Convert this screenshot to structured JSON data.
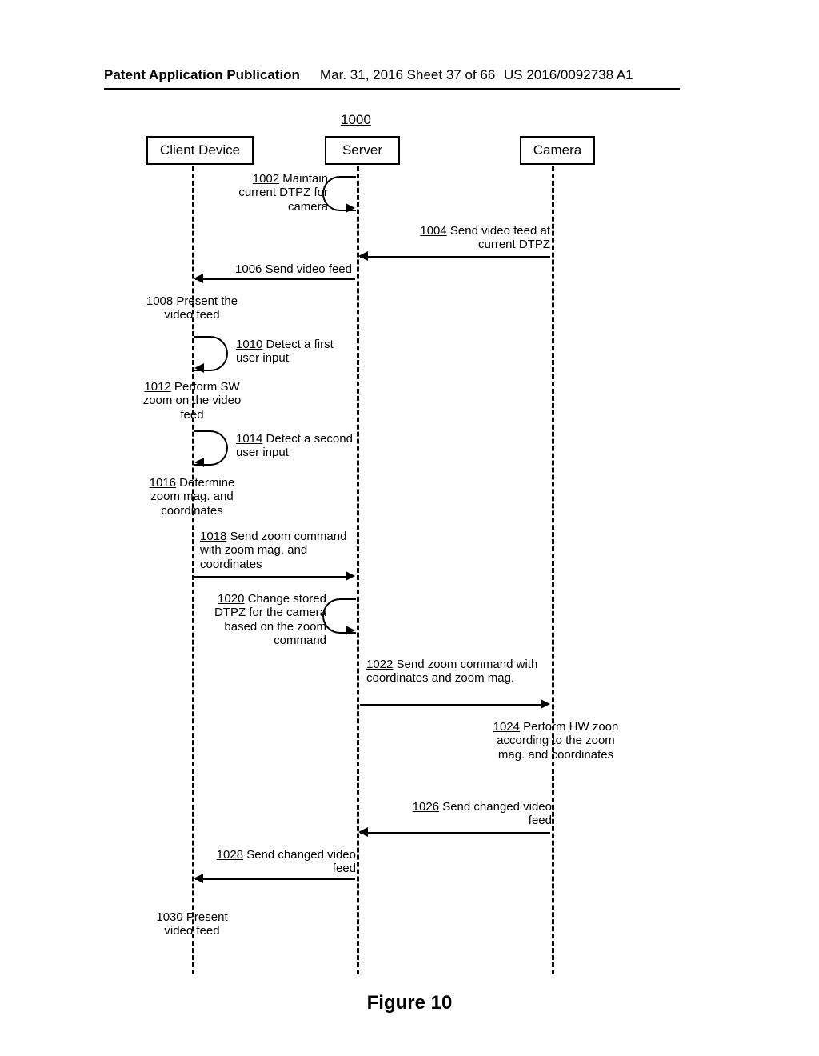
{
  "header": {
    "left": "Patent Application Publication",
    "mid": "Mar. 31, 2016  Sheet 37 of 66",
    "right": "US 2016/0092738 A1"
  },
  "figure": {
    "number": "1000",
    "caption": "Figure 10",
    "actors": {
      "client": "Client Device",
      "server": "Server",
      "camera": "Camera"
    },
    "steps": {
      "s1002_num": "1002",
      "s1002_txt": " Maintain current DTPZ for camera",
      "s1004_num": "1004",
      "s1004_txt": " Send video feed at current DTPZ",
      "s1006_num": "1006",
      "s1006_txt": " Send video feed",
      "s1008_num": "1008",
      "s1008_txt": " Present the video feed",
      "s1010_num": "1010",
      "s1010_txt": " Detect a first user input",
      "s1012_num": "1012",
      "s1012_txt": " Perform SW zoom on the video feed",
      "s1014_num": "1014",
      "s1014_txt": " Detect a second user input",
      "s1016_num": "1016",
      "s1016_txt": " Determine zoom mag. and coordinates",
      "s1018_num": "1018",
      "s1018_txt": " Send zoom command with zoom mag. and coordinates",
      "s1020_num": "1020",
      "s1020_txt": " Change stored DTPZ for the camera based on the zoom command",
      "s1022_num": "1022",
      "s1022_txt": " Send zoom command with coordinates and zoom mag.",
      "s1024_num": "1024",
      "s1024_txt": " Perform HW zoon according to the zoom mag. and coordinates",
      "s1026_num": "1026",
      "s1026_txt": " Send changed video feed",
      "s1028_num": "1028",
      "s1028_txt": " Send changed video feed",
      "s1030_num": "1030",
      "s1030_txt": " Present video feed"
    }
  }
}
